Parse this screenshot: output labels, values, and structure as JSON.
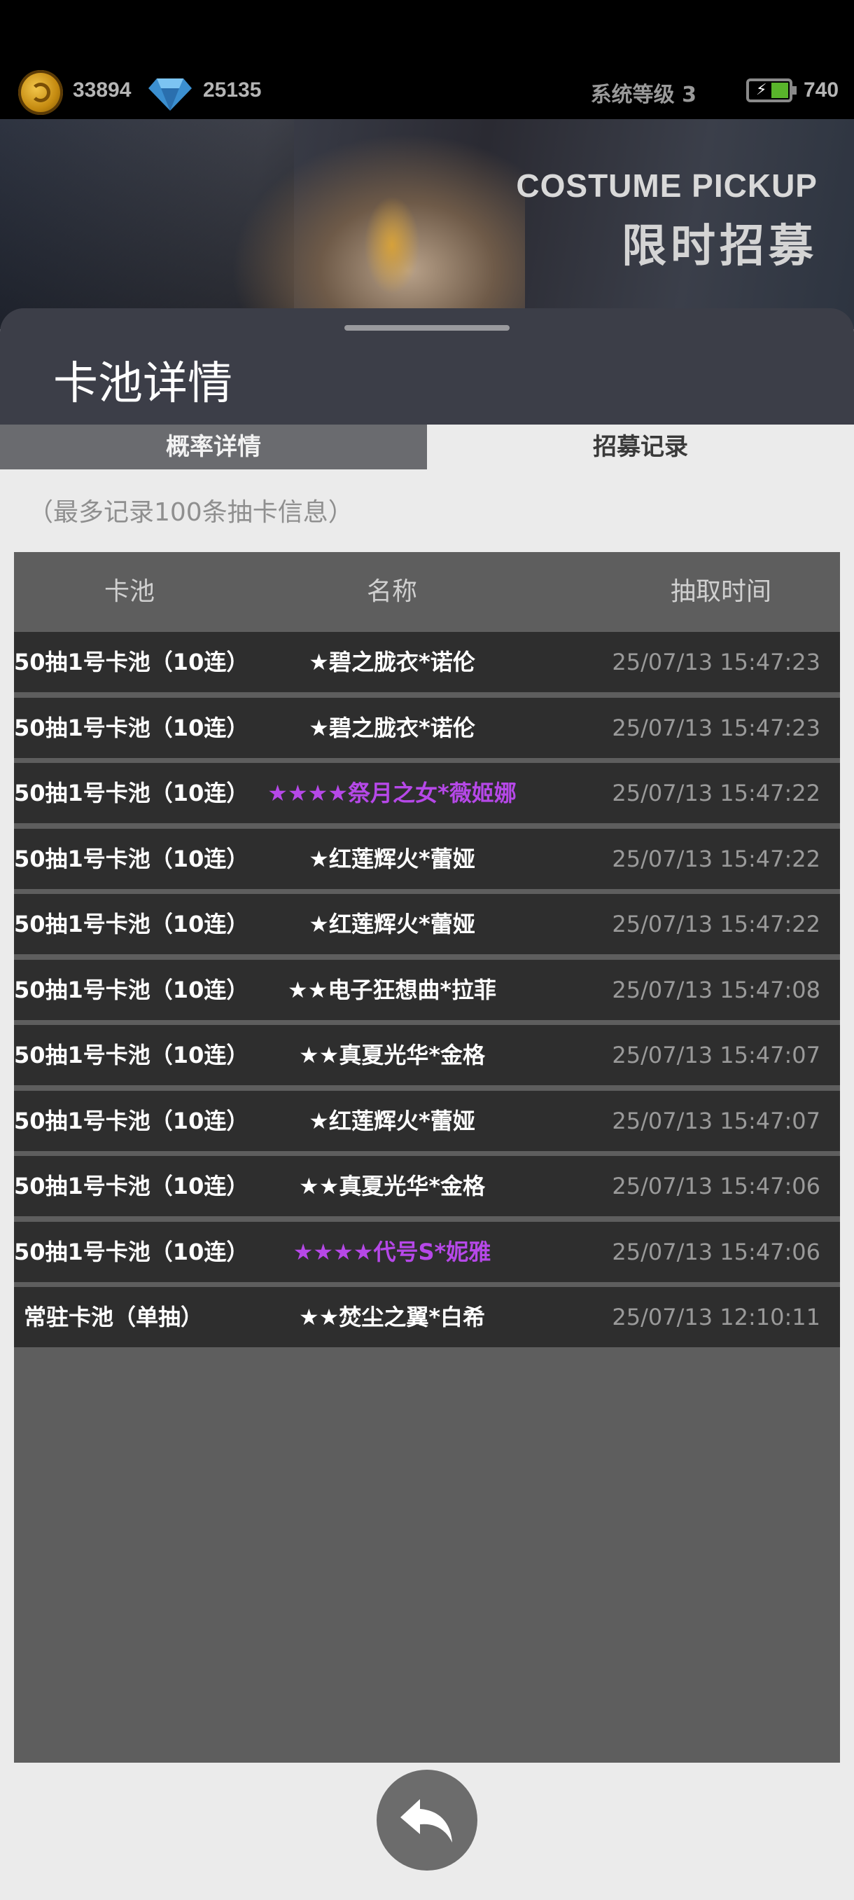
{
  "status": {
    "coins": "33894",
    "gems": "25135",
    "system_level": "系统等级 3",
    "energy": "740"
  },
  "banner": {
    "title_en": "COSTUME PICKUP",
    "title_cn": "限时招募"
  },
  "sheet": {
    "title": "卡池详情",
    "tabs": [
      "概率详情",
      "招募记录"
    ],
    "hint": "（最多记录100条抽卡信息）"
  },
  "table": {
    "headers": [
      "卡池",
      "名称",
      "抽取时间"
    ],
    "rows": [
      {
        "pool": "50抽1号卡池（10连）",
        "name": "★碧之胧衣*诺伦",
        "time": "25/07/13 15:47:23",
        "rarity": "normal"
      },
      {
        "pool": "50抽1号卡池（10连）",
        "name": "★碧之胧衣*诺伦",
        "time": "25/07/13 15:47:23",
        "rarity": "normal"
      },
      {
        "pool": "50抽1号卡池（10连）",
        "name": "★★★★祭月之女*薇姬娜",
        "time": "25/07/13 15:47:22",
        "rarity": "high"
      },
      {
        "pool": "50抽1号卡池（10连）",
        "name": "★红莲辉火*蕾娅",
        "time": "25/07/13 15:47:22",
        "rarity": "normal"
      },
      {
        "pool": "50抽1号卡池（10连）",
        "name": "★红莲辉火*蕾娅",
        "time": "25/07/13 15:47:22",
        "rarity": "normal"
      },
      {
        "pool": "50抽1号卡池（10连）",
        "name": "★★电子狂想曲*拉菲",
        "time": "25/07/13 15:47:08",
        "rarity": "normal"
      },
      {
        "pool": "50抽1号卡池（10连）",
        "name": "★★真夏光华*金格",
        "time": "25/07/13 15:47:07",
        "rarity": "normal"
      },
      {
        "pool": "50抽1号卡池（10连）",
        "name": "★红莲辉火*蕾娅",
        "time": "25/07/13 15:47:07",
        "rarity": "normal"
      },
      {
        "pool": "50抽1号卡池（10连）",
        "name": "★★真夏光华*金格",
        "time": "25/07/13 15:47:06",
        "rarity": "normal"
      },
      {
        "pool": "50抽1号卡池（10连）",
        "name": "★★★★代号S*妮雅",
        "time": "25/07/13 15:47:06",
        "rarity": "high"
      },
      {
        "pool": "常驻卡池（单抽）",
        "name": "★★焚尘之翼*白希",
        "time": "25/07/13 12:10:11",
        "rarity": "normal"
      }
    ]
  },
  "colors": {
    "high_rarity": "#b648e8",
    "row_bg": "#2e2e2e",
    "table_bg": "#5e5e5e"
  },
  "icons": [
    "coin-icon",
    "gem-icon",
    "battery-icon",
    "back-arrow-icon"
  ]
}
